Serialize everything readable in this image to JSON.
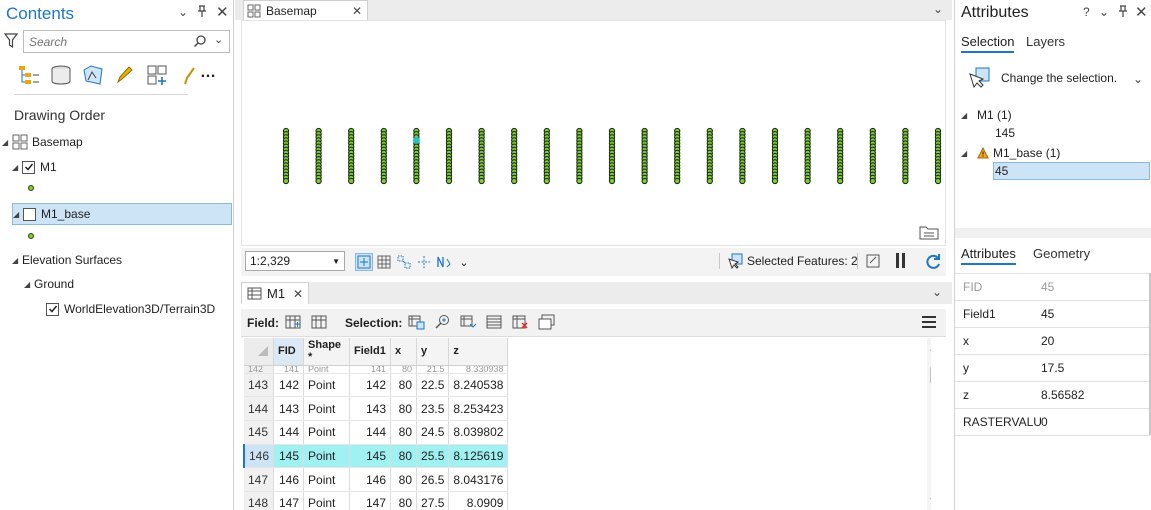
{
  "contents": {
    "title": "Contents",
    "search_placeholder": "Search",
    "drawing_order_label": "Drawing Order",
    "layers": {
      "basemap": "Basemap",
      "m1": "M1",
      "m1_base": "M1_base",
      "elevation_surfaces": "Elevation Surfaces",
      "ground": "Ground",
      "terrain": "WorldElevation3D/Terrain3D"
    }
  },
  "map": {
    "tab_label": "Basemap",
    "scale": "1:2,329",
    "selected_features": "Selected Features: 2"
  },
  "table": {
    "tab_label": "M1",
    "field_label": "Field:",
    "selection_label": "Selection:",
    "columns": [
      "FID",
      "Shape *",
      "Field1",
      "x",
      "y",
      "z"
    ],
    "partial_row": [
      "142",
      "141",
      "Point",
      "141",
      "80",
      "21.5",
      "8.330938"
    ],
    "rows": [
      [
        "143",
        "142",
        "Point",
        "142",
        "80",
        "22.5",
        "8.240538"
      ],
      [
        "144",
        "143",
        "Point",
        "143",
        "80",
        "23.5",
        "8.253423"
      ],
      [
        "145",
        "144",
        "Point",
        "144",
        "80",
        "24.5",
        "8.039802"
      ],
      [
        "146",
        "145",
        "Point",
        "145",
        "80",
        "25.5",
        "8.125619"
      ],
      [
        "147",
        "146",
        "Point",
        "146",
        "80",
        "26.5",
        "8.043176"
      ],
      [
        "148",
        "147",
        "Point",
        "147",
        "80",
        "27.5",
        "8.0909"
      ]
    ],
    "selected_index": 3
  },
  "attributes": {
    "title": "Attributes",
    "help": "?",
    "tabs": [
      "Selection",
      "Layers"
    ],
    "change_selection": "Change the selection.",
    "tree": {
      "m1": "M1 (1)",
      "m1_id": "145",
      "m1_base": "M1_base (1)",
      "m1_base_id": "45"
    },
    "detail_tabs": [
      "Attributes",
      "Geometry"
    ],
    "fields": [
      {
        "k": "FID",
        "v": "45"
      },
      {
        "k": "Field1",
        "v": "45"
      },
      {
        "k": "x",
        "v": "20"
      },
      {
        "k": "y",
        "v": "17.5"
      },
      {
        "k": "z",
        "v": "8.56582"
      },
      {
        "k": "RASTERVALU",
        "v": "0"
      }
    ]
  },
  "colors": {
    "accent": "#1d76c6",
    "selected_row": "#9ff1f2",
    "selected_tree": "#cde4f7",
    "point_green": "#7ad12b",
    "point_dark": "#1f2a1a",
    "selected_point": "#1fc3c8"
  }
}
